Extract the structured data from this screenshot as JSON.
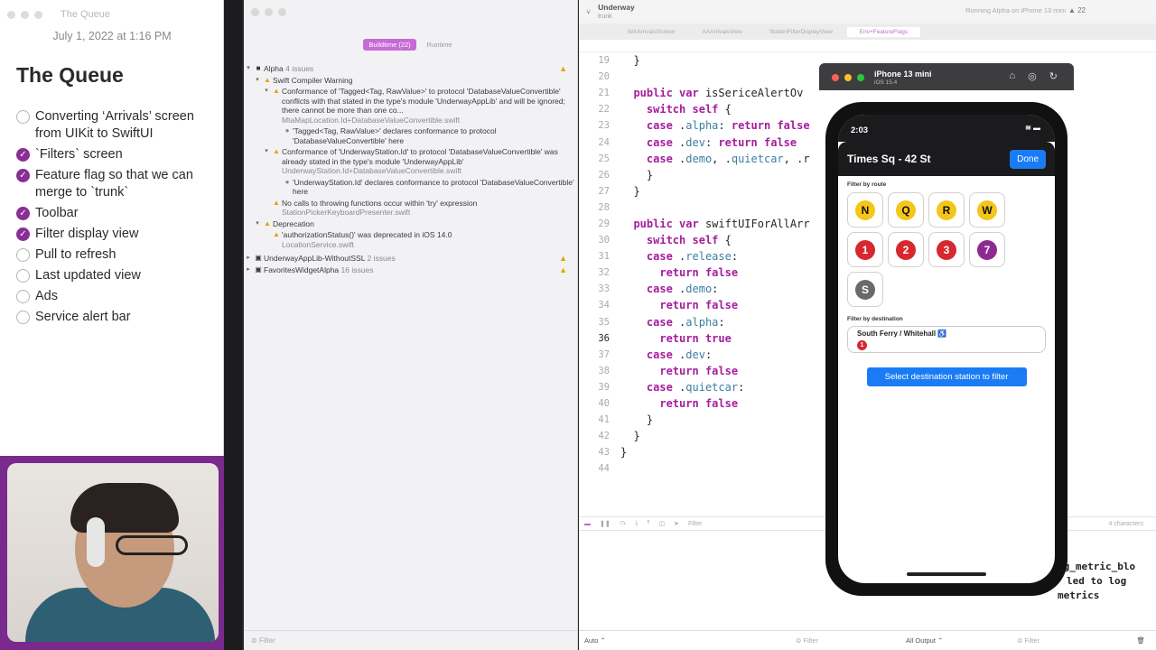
{
  "notes": {
    "window_title": "The Queue",
    "date": "July 1, 2022 at 1:16 PM",
    "title": "The Queue",
    "items": [
      {
        "label": "Converting ‘Arrivals’ screen from UIKit to SwiftUI",
        "checked": false
      },
      {
        "label": "`Filters` screen",
        "checked": true
      },
      {
        "label": "Feature flag so that we can merge to `trunk`",
        "checked": true
      },
      {
        "label": "Toolbar",
        "checked": true
      },
      {
        "label": "Filter display view",
        "checked": true
      },
      {
        "label": "Pull to refresh",
        "checked": false
      },
      {
        "label": "Last updated view",
        "checked": false
      },
      {
        "label": "Ads",
        "checked": false
      },
      {
        "label": "Service alert bar",
        "checked": false
      }
    ]
  },
  "navigator": {
    "tabs": [
      "Buildtime (22)",
      "Runtime"
    ],
    "group_alpha": "Alpha",
    "group_alpha_count": "4 issues",
    "swift_compiler_warning": "Swift Compiler Warning",
    "issues": [
      {
        "text": "Conformance of 'Tagged<Tag, RawValue>' to protocol 'DatabaseValueConvertible' conflicts with that stated in the type's module 'UnderwayAppLib' and will be ignored; there cannot be more than one co...",
        "file": "MtaMapLocation.Id+DatabaseValueConvertible.swift"
      },
      {
        "text": "'Tagged<Tag, RawValue>' declares conformance to protocol 'DatabaseValueConvertible' here",
        "file": ""
      },
      {
        "text": "Conformance of 'UnderwayStation.Id' to protocol 'DatabaseValueConvertible' was already stated in the type's module 'UnderwayAppLib'",
        "file": "UnderwayStation.Id+DatabaseValueConvertible.swift"
      },
      {
        "text": "'UnderwayStation.Id' declares conformance to protocol 'DatabaseValueConvertible' here",
        "file": ""
      },
      {
        "text": "No calls to throwing functions occur within 'try' expression",
        "file": "StationPickerKeyboardPresenter.swift"
      }
    ],
    "deprecation": "Deprecation",
    "deprecation_issue": "'authorizationStatus()' was deprecated in iOS 14.0",
    "deprecation_file": "LocationService.swift",
    "group2": "UnderwayAppLib-WithoutSSL",
    "group2_count": "2 issues",
    "group3": "FavoritesWidgetAlpha",
    "group3_count": "16 issues",
    "filter_placeholder": "Filter"
  },
  "editor": {
    "project": "Underway",
    "branch": "trunk",
    "run_status": "Running Alpha on iPhone 13 mini",
    "warning_count": "22",
    "file_tabs": [
      "WAArrivalsScreen",
      "AAArrivalsView",
      "StationFilterDisplayView",
      "Env+FeatureFlags"
    ],
    "lines": [
      {
        "n": "19",
        "code": "  }"
      },
      {
        "n": "20",
        "code": ""
      },
      {
        "n": "21",
        "code": "  public var isSericeAlertOv"
      },
      {
        "n": "22",
        "code": "    switch self {"
      },
      {
        "n": "23",
        "code": "    case .alpha: return false"
      },
      {
        "n": "24",
        "code": "    case .dev: return false"
      },
      {
        "n": "25",
        "code": "    case .demo, .quietcar, .r"
      },
      {
        "n": "26",
        "code": "    }"
      },
      {
        "n": "27",
        "code": "  }"
      },
      {
        "n": "28",
        "code": ""
      },
      {
        "n": "29",
        "code": "  public var swiftUIForAllArr"
      },
      {
        "n": "30",
        "code": "    switch self {"
      },
      {
        "n": "31",
        "code": "    case .release:"
      },
      {
        "n": "32",
        "code": "      return false"
      },
      {
        "n": "33",
        "code": "    case .demo:"
      },
      {
        "n": "34",
        "code": "      return false"
      },
      {
        "n": "35",
        "code": "    case .alpha:"
      },
      {
        "n": "36",
        "code": "      return true"
      },
      {
        "n": "37",
        "code": "    case .dev:"
      },
      {
        "n": "38",
        "code": "      return false"
      },
      {
        "n": "39",
        "code": "    case .quietcar:"
      },
      {
        "n": "40",
        "code": "      return false"
      },
      {
        "n": "41",
        "code": "    }"
      },
      {
        "n": "42",
        "code": "  }"
      },
      {
        "n": "43",
        "code": "}"
      },
      {
        "n": "44",
        "code": ""
      }
    ],
    "current_line": "36",
    "debug_filter": "Filter",
    "char_count": "4 characters",
    "console_lines": [
      "og_metric_blo",
      "led to log",
      "metrics"
    ],
    "bottom_auto": "Auto ⌃",
    "bottom_filter": "Filter",
    "bottom_output": "All Output ⌃",
    "bottom_filter2": "Filter"
  },
  "simulator": {
    "device": "iPhone 13 mini",
    "os": "iOS 15.4",
    "time": "2:03",
    "screen_title": "Times Sq - 42 St",
    "done_label": "Done",
    "filter_by_route": "Filter by route",
    "routes": [
      {
        "label": "N",
        "color": "#f5c518",
        "text": "#111111"
      },
      {
        "label": "Q",
        "color": "#f5c518",
        "text": "#111111"
      },
      {
        "label": "R",
        "color": "#f5c518",
        "text": "#111111"
      },
      {
        "label": "W",
        "color": "#f5c518",
        "text": "#111111"
      },
      {
        "label": "1",
        "color": "#d7272f",
        "text": "#ffffff"
      },
      {
        "label": "2",
        "color": "#d7272f",
        "text": "#ffffff"
      },
      {
        "label": "3",
        "color": "#d7272f",
        "text": "#ffffff"
      },
      {
        "label": "7",
        "color": "#8e2a8f",
        "text": "#ffffff"
      },
      {
        "label": "S",
        "color": "#6a6a6a",
        "text": "#ffffff"
      }
    ],
    "filter_by_destination": "Filter by destination",
    "destination": "South Ferry / Whitehall",
    "destination_route": "1",
    "select_button": "Select destination station to filter"
  },
  "colors": {
    "accent": "#8a2e96",
    "ios_blue": "#1a7cf5",
    "warning": "#e2a400"
  }
}
